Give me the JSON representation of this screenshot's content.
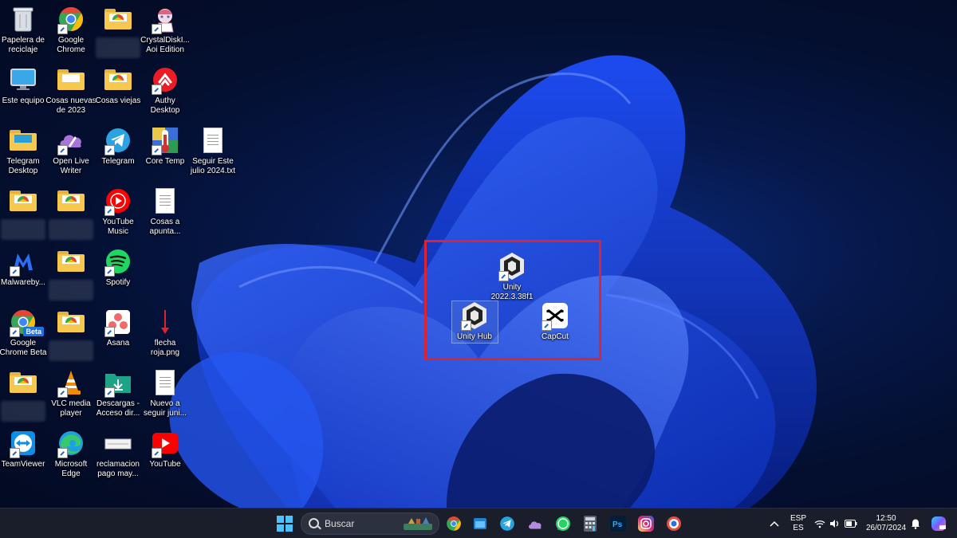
{
  "desktop": {
    "icons": {
      "recycle": "Papelera de\nreciclaje",
      "chrome": "Google\nChrome",
      "crystal": "CrystalDiskI...\nAoi Edition",
      "este_equipo": "Este equipo",
      "cosas_nuevas": "Cosas nuevas\nde 2023",
      "cosas_viejas": "Cosas viejas",
      "authy": "Authy\nDesktop",
      "telegram_desktop": "Telegram\nDesktop",
      "open_live_writer": "Open Live\nWriter",
      "telegram": "Telegram",
      "core_temp": "Core Temp",
      "seguir_este": "Seguir Este\njulio 2024.txt",
      "youtube_music": "YouTube\nMusic",
      "cosas_apunta": "Cosas a\napunta...",
      "malwarebytes": "Malwareby...",
      "spotify": "Spotify",
      "chrome_beta": "Google\nChrome Beta",
      "asana": "Asana",
      "flecha_roja": "flecha\nroja.png",
      "vlc": "VLC media\nplayer",
      "descargas": "Descargas -\nAcceso dir...",
      "nuevo_a_seguir": "Nuevo a\nseguir juni...",
      "teamviewer": "TeamViewer",
      "edge": "Microsoft\nEdge",
      "reclamacion": "reclamacion\npago may...",
      "youtube": "YouTube",
      "unity": "Unity\n2022.3.38f1",
      "unity_hub": "Unity Hub",
      "capcut": "CapCut"
    },
    "icon_names": {
      "beta_badge": "Beta"
    }
  },
  "taskbar": {
    "search_placeholder": "Buscar",
    "lang_top": "ESP",
    "lang_bottom": "ES",
    "time": "12:50",
    "date": "26/07/2024"
  },
  "colors": {
    "selection_border": "#e0222e",
    "wallpaper_blue": "#1a45e0"
  }
}
